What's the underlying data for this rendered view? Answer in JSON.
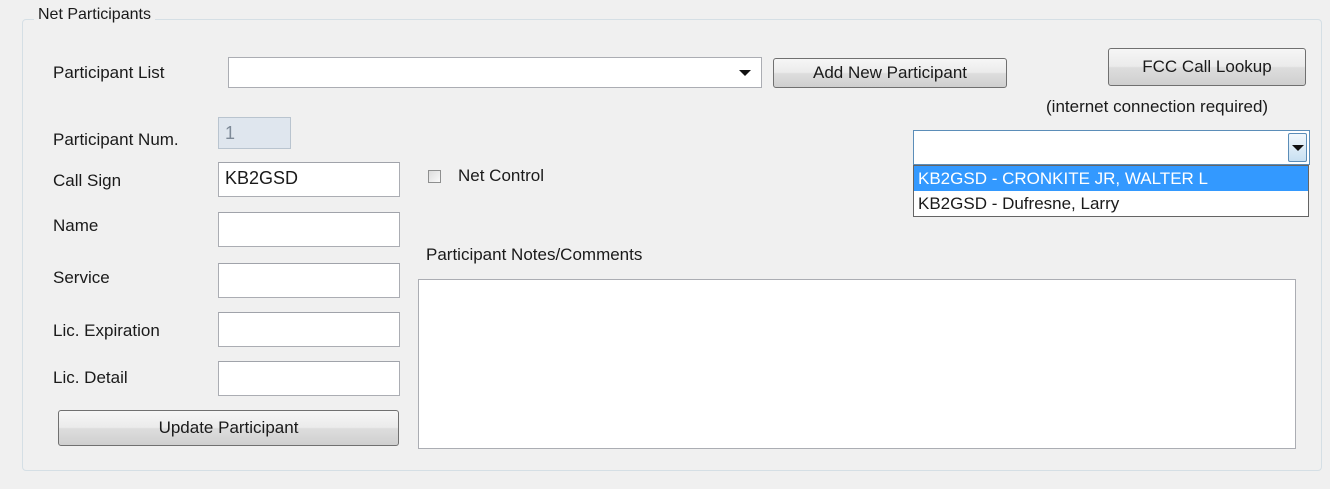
{
  "group": {
    "title": "Net Participants"
  },
  "participant_list": {
    "label": "Participant List",
    "value": ""
  },
  "buttons": {
    "add_new": "Add New Participant",
    "fcc_lookup": "FCC Call Lookup",
    "update": "Update Participant"
  },
  "fcc_note": "(internet connection required)",
  "fields": {
    "participant_num": {
      "label": "Participant Num.",
      "value": "1"
    },
    "call_sign": {
      "label": "Call Sign",
      "value": "KB2GSD"
    },
    "name": {
      "label": "Name",
      "value": ""
    },
    "service": {
      "label": "Service",
      "value": ""
    },
    "lic_expiration": {
      "label": "Lic. Expiration",
      "value": ""
    },
    "lic_detail": {
      "label": "Lic. Detail",
      "value": ""
    }
  },
  "net_control": {
    "label": "Net Control",
    "checked": false
  },
  "notes": {
    "label": "Participant Notes/Comments",
    "value": ""
  },
  "lookup_combo": {
    "value": "",
    "options": [
      {
        "text": "KB2GSD - CRONKITE JR, WALTER L",
        "selected": true
      },
      {
        "text": "KB2GSD - Dufresne, Larry",
        "selected": false
      }
    ]
  },
  "icons": {
    "dropdown": "chevron-down-icon"
  }
}
